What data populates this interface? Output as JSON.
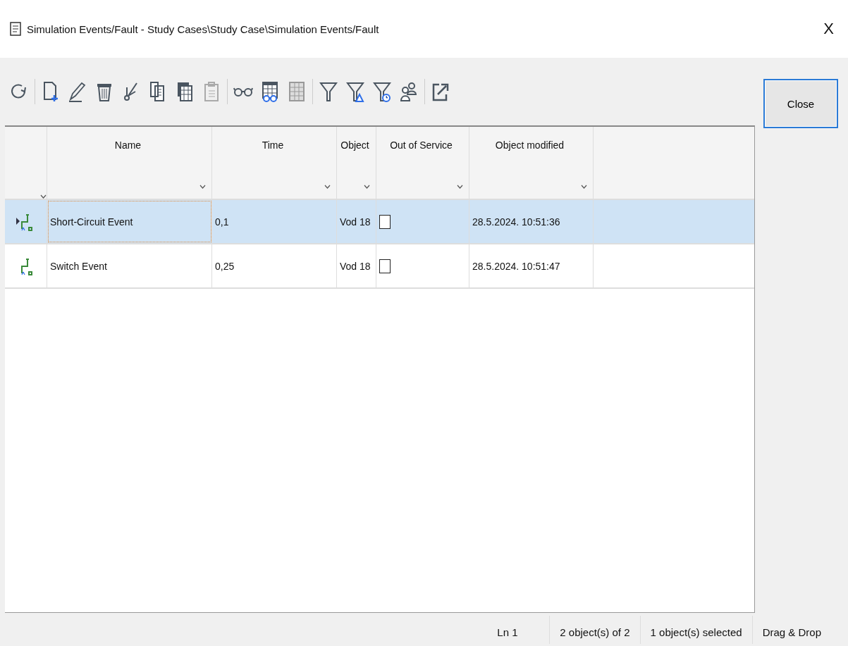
{
  "window": {
    "title": "Simulation Events/Fault - Study Cases\\Study Case\\Simulation Events/Fault",
    "close_glyph": "X"
  },
  "close_button": "Close",
  "table": {
    "columns": [
      {},
      {
        "label": "Name"
      },
      {
        "label": "Time"
      },
      {
        "label": "Object"
      },
      {
        "label": "Out of Service"
      },
      {
        "label": "Object modified"
      }
    ],
    "rows": [
      {
        "selected": true,
        "name": "Short-Circuit Event",
        "time": "0,1",
        "object": "Vod 18",
        "out_of_service": false,
        "modified": "28.5.2024. 10:51:36"
      },
      {
        "selected": false,
        "name": "Switch Event",
        "time": "0,25",
        "object": "Vod 18",
        "out_of_service": false,
        "modified": "28.5.2024. 10:51:47"
      }
    ]
  },
  "status_bar": [
    "Ln 1",
    "2 object(s) of 2",
    "1 object(s) selected",
    "Drag & Drop"
  ]
}
